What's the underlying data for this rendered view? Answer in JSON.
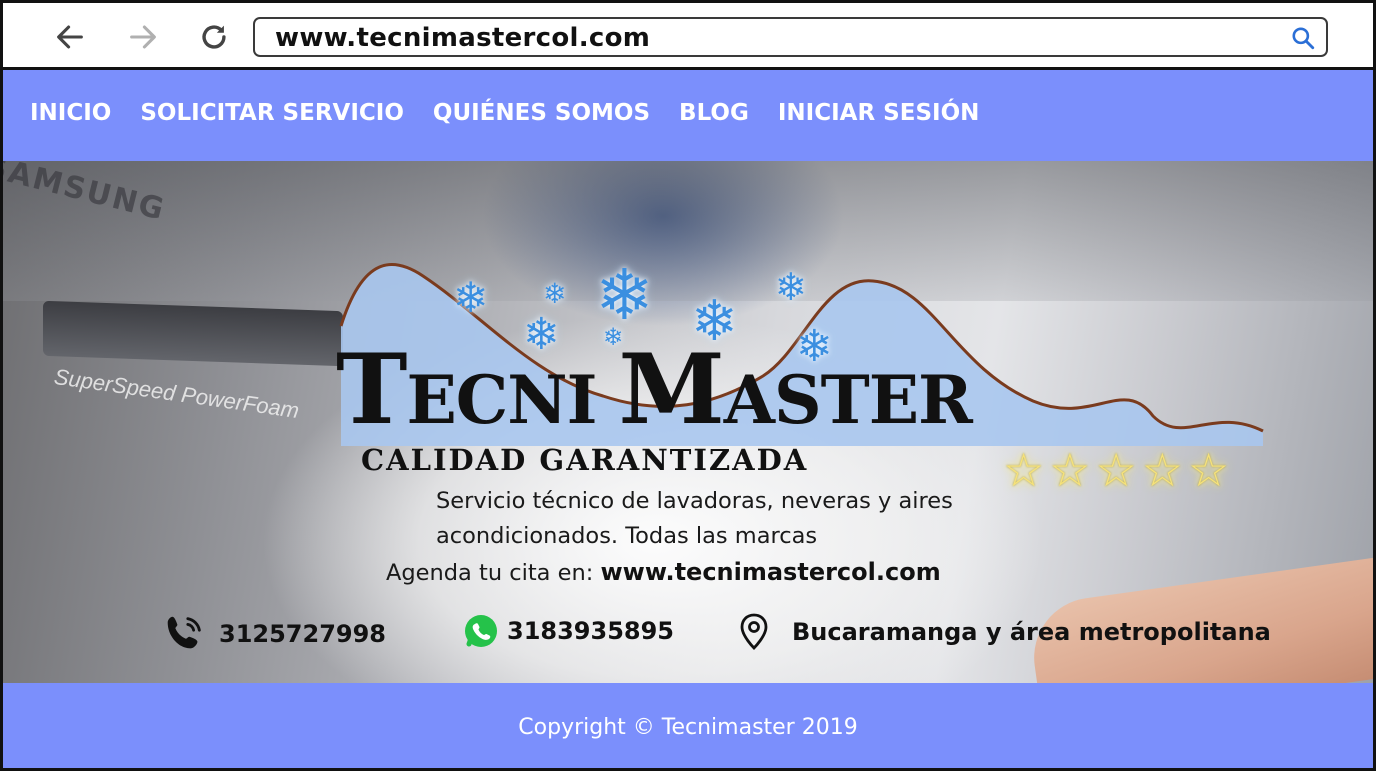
{
  "browser": {
    "back_icon": "arrow-left-icon",
    "forward_icon": "arrow-right-icon",
    "reload_icon": "reload-icon",
    "url": "www.tecnimastercol.com",
    "search_icon": "search-icon"
  },
  "nav": {
    "items": [
      {
        "label": "INICIO"
      },
      {
        "label": "SOLICITAR SERVICIO"
      },
      {
        "label": "QUIÉNES SOMOS"
      },
      {
        "label": "BLOG"
      },
      {
        "label": "INICIAR SESIÓN"
      }
    ],
    "background": "#7b8ffc"
  },
  "hero": {
    "logo_word1_initial": "T",
    "logo_word1_rest": "ECNI",
    "logo_word2_initial": "M",
    "logo_word2_rest": "ASTER",
    "tagline": "CALIDAD GARANTIZADA",
    "rating_stars": 5,
    "description": "Servicio técnico de lavadoras, neveras y aires acondicionados. Todas las marcas",
    "agenda_prefix": "Agenda tu cita en:",
    "agenda_url": "www.tecnimastercol.com",
    "phone": "3125727998",
    "whatsapp": "3183935895",
    "location": "Bucaramanga y área metropolitana",
    "appliance_brand": "SAMSUNG",
    "appliance_model": "SuperSpeed PowerFoam"
  },
  "footer": {
    "copyright": "Copyright © Tecnimaster 2019"
  }
}
